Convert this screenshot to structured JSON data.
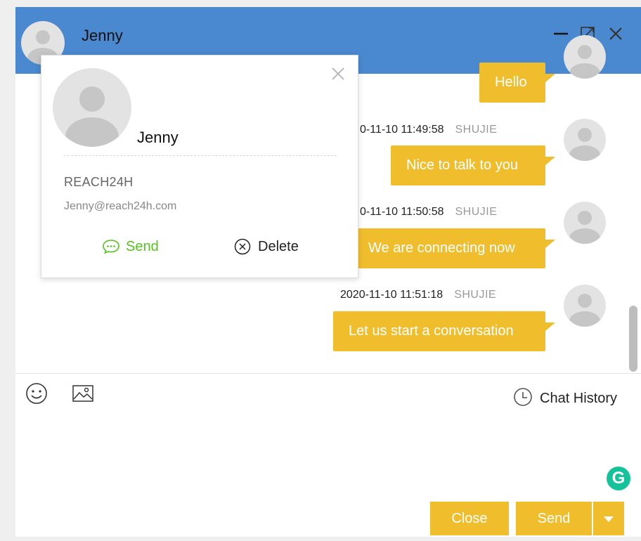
{
  "header": {
    "contact_name": "Jenny",
    "minimize_icon": "minimize-icon",
    "expand_icon": "expand-icon",
    "close_icon": "close-icon"
  },
  "messages": [
    {
      "timestamp": "",
      "sender": "",
      "text": "Hello"
    },
    {
      "timestamp": "0-11-10 11:49:58",
      "sender": "SHUJIE",
      "text": "Nice to talk to you"
    },
    {
      "timestamp": "0-11-10 11:50:58",
      "sender": "SHUJIE",
      "text": "We are connecting now"
    },
    {
      "timestamp": "2020-11-10 11:51:18",
      "sender": "SHUJIE",
      "text": "Let us start a conversation"
    }
  ],
  "toolbar": {
    "emoji_icon": "emoji-icon",
    "image_icon": "image-icon",
    "history_label": "Chat History"
  },
  "composer": {
    "value": ""
  },
  "grammarly": {
    "label": "G"
  },
  "footer": {
    "close_label": "Close",
    "send_label": "Send"
  },
  "contact_card": {
    "name": "Jenny",
    "company": "REACH24H",
    "email": "Jenny@reach24h.com",
    "send_label": "Send",
    "delete_label": "Delete"
  },
  "colors": {
    "header_blue": "#4a88cf",
    "bubble_yellow": "#f0bd2d",
    "send_green": "#52c41a",
    "grammarly_green": "#15c39a"
  }
}
